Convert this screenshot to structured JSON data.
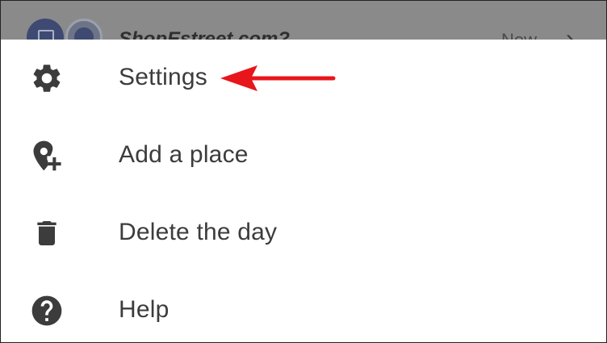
{
  "background": {
    "title": "ShopEstreet.com?",
    "time": "Now",
    "chevron": "›"
  },
  "menu": {
    "items": [
      {
        "label": "Settings",
        "icon": "gear-icon"
      },
      {
        "label": "Add a place",
        "icon": "add-location-icon"
      },
      {
        "label": "Delete the day",
        "icon": "trash-icon"
      },
      {
        "label": "Help",
        "icon": "help-icon"
      }
    ]
  },
  "annotation": {
    "arrow_color": "#e8151b",
    "points_to": "Settings"
  },
  "colors": {
    "icon": "#3c3c3c",
    "text": "#3c3c3c",
    "scrim": "#8a8a8a"
  }
}
